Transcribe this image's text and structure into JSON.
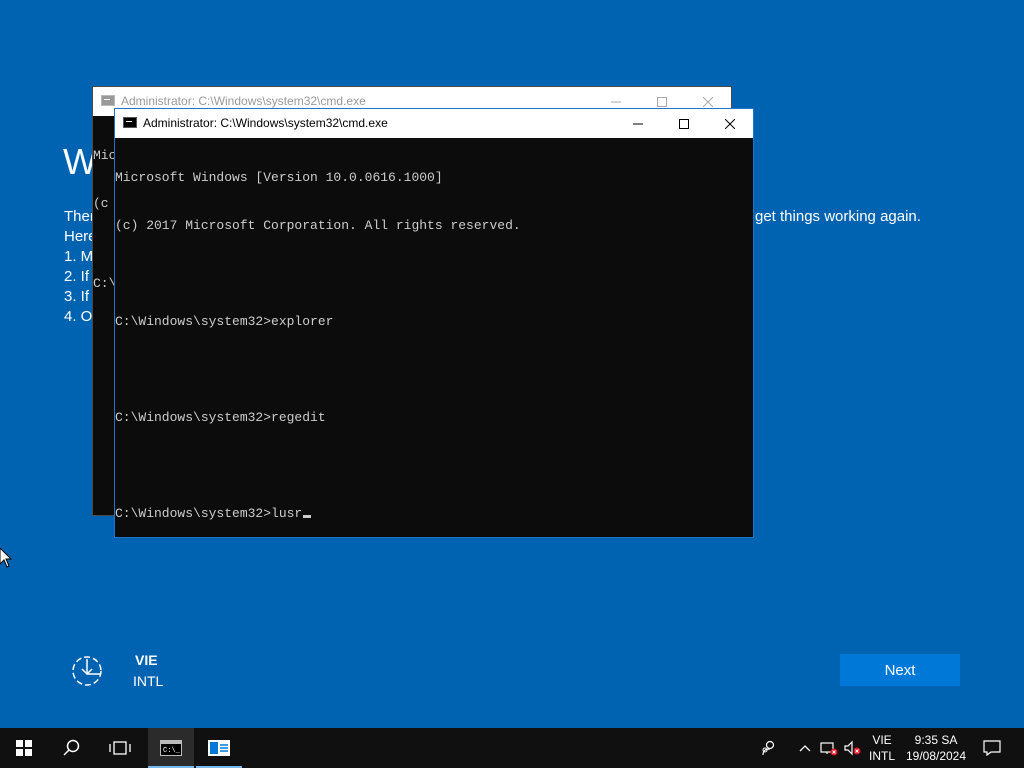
{
  "oobe": {
    "title_partial": "W",
    "lines_partial": [
      "Ther",
      "Here",
      "1. M",
      "2. If",
      "3. If",
      "4. O"
    ],
    "right_text": "get things working again.",
    "language_code": "VIE",
    "keyboard_layout": "INTL",
    "next_label": "Next",
    "accessibility_icon": "ease-of-access-icon"
  },
  "back_window": {
    "title": "Administrator: C:\\Windows\\system32\\cmd.exe",
    "visible_lines": [
      "Mic",
      "(c",
      "",
      "C:\\"
    ]
  },
  "front_window": {
    "title": "Administrator: C:\\Windows\\system32\\cmd.exe",
    "lines": [
      "Microsoft Windows [Version 10.0.0616.1000]",
      "(c) 2017 Microsoft Corporation. All rights reserved.",
      "",
      "C:\\Windows\\system32>explorer",
      "",
      "C:\\Windows\\system32>regedit",
      "",
      "C:\\Windows\\system32>lusr"
    ],
    "text_color": "#cccccc",
    "background": "#0c0c0c"
  },
  "taskbar": {
    "items": [
      "start-icon",
      "search-icon",
      "task-view-icon",
      "cmd-icon",
      "app-icon"
    ],
    "tray": {
      "lang_top": "VIE",
      "lang_bottom": "INTL",
      "time": "9:35 SA",
      "date": "19/08/2024"
    }
  },
  "colors": {
    "desktop": "#0063b1",
    "next_button": "#0078d7",
    "taskbar": "#101010"
  }
}
